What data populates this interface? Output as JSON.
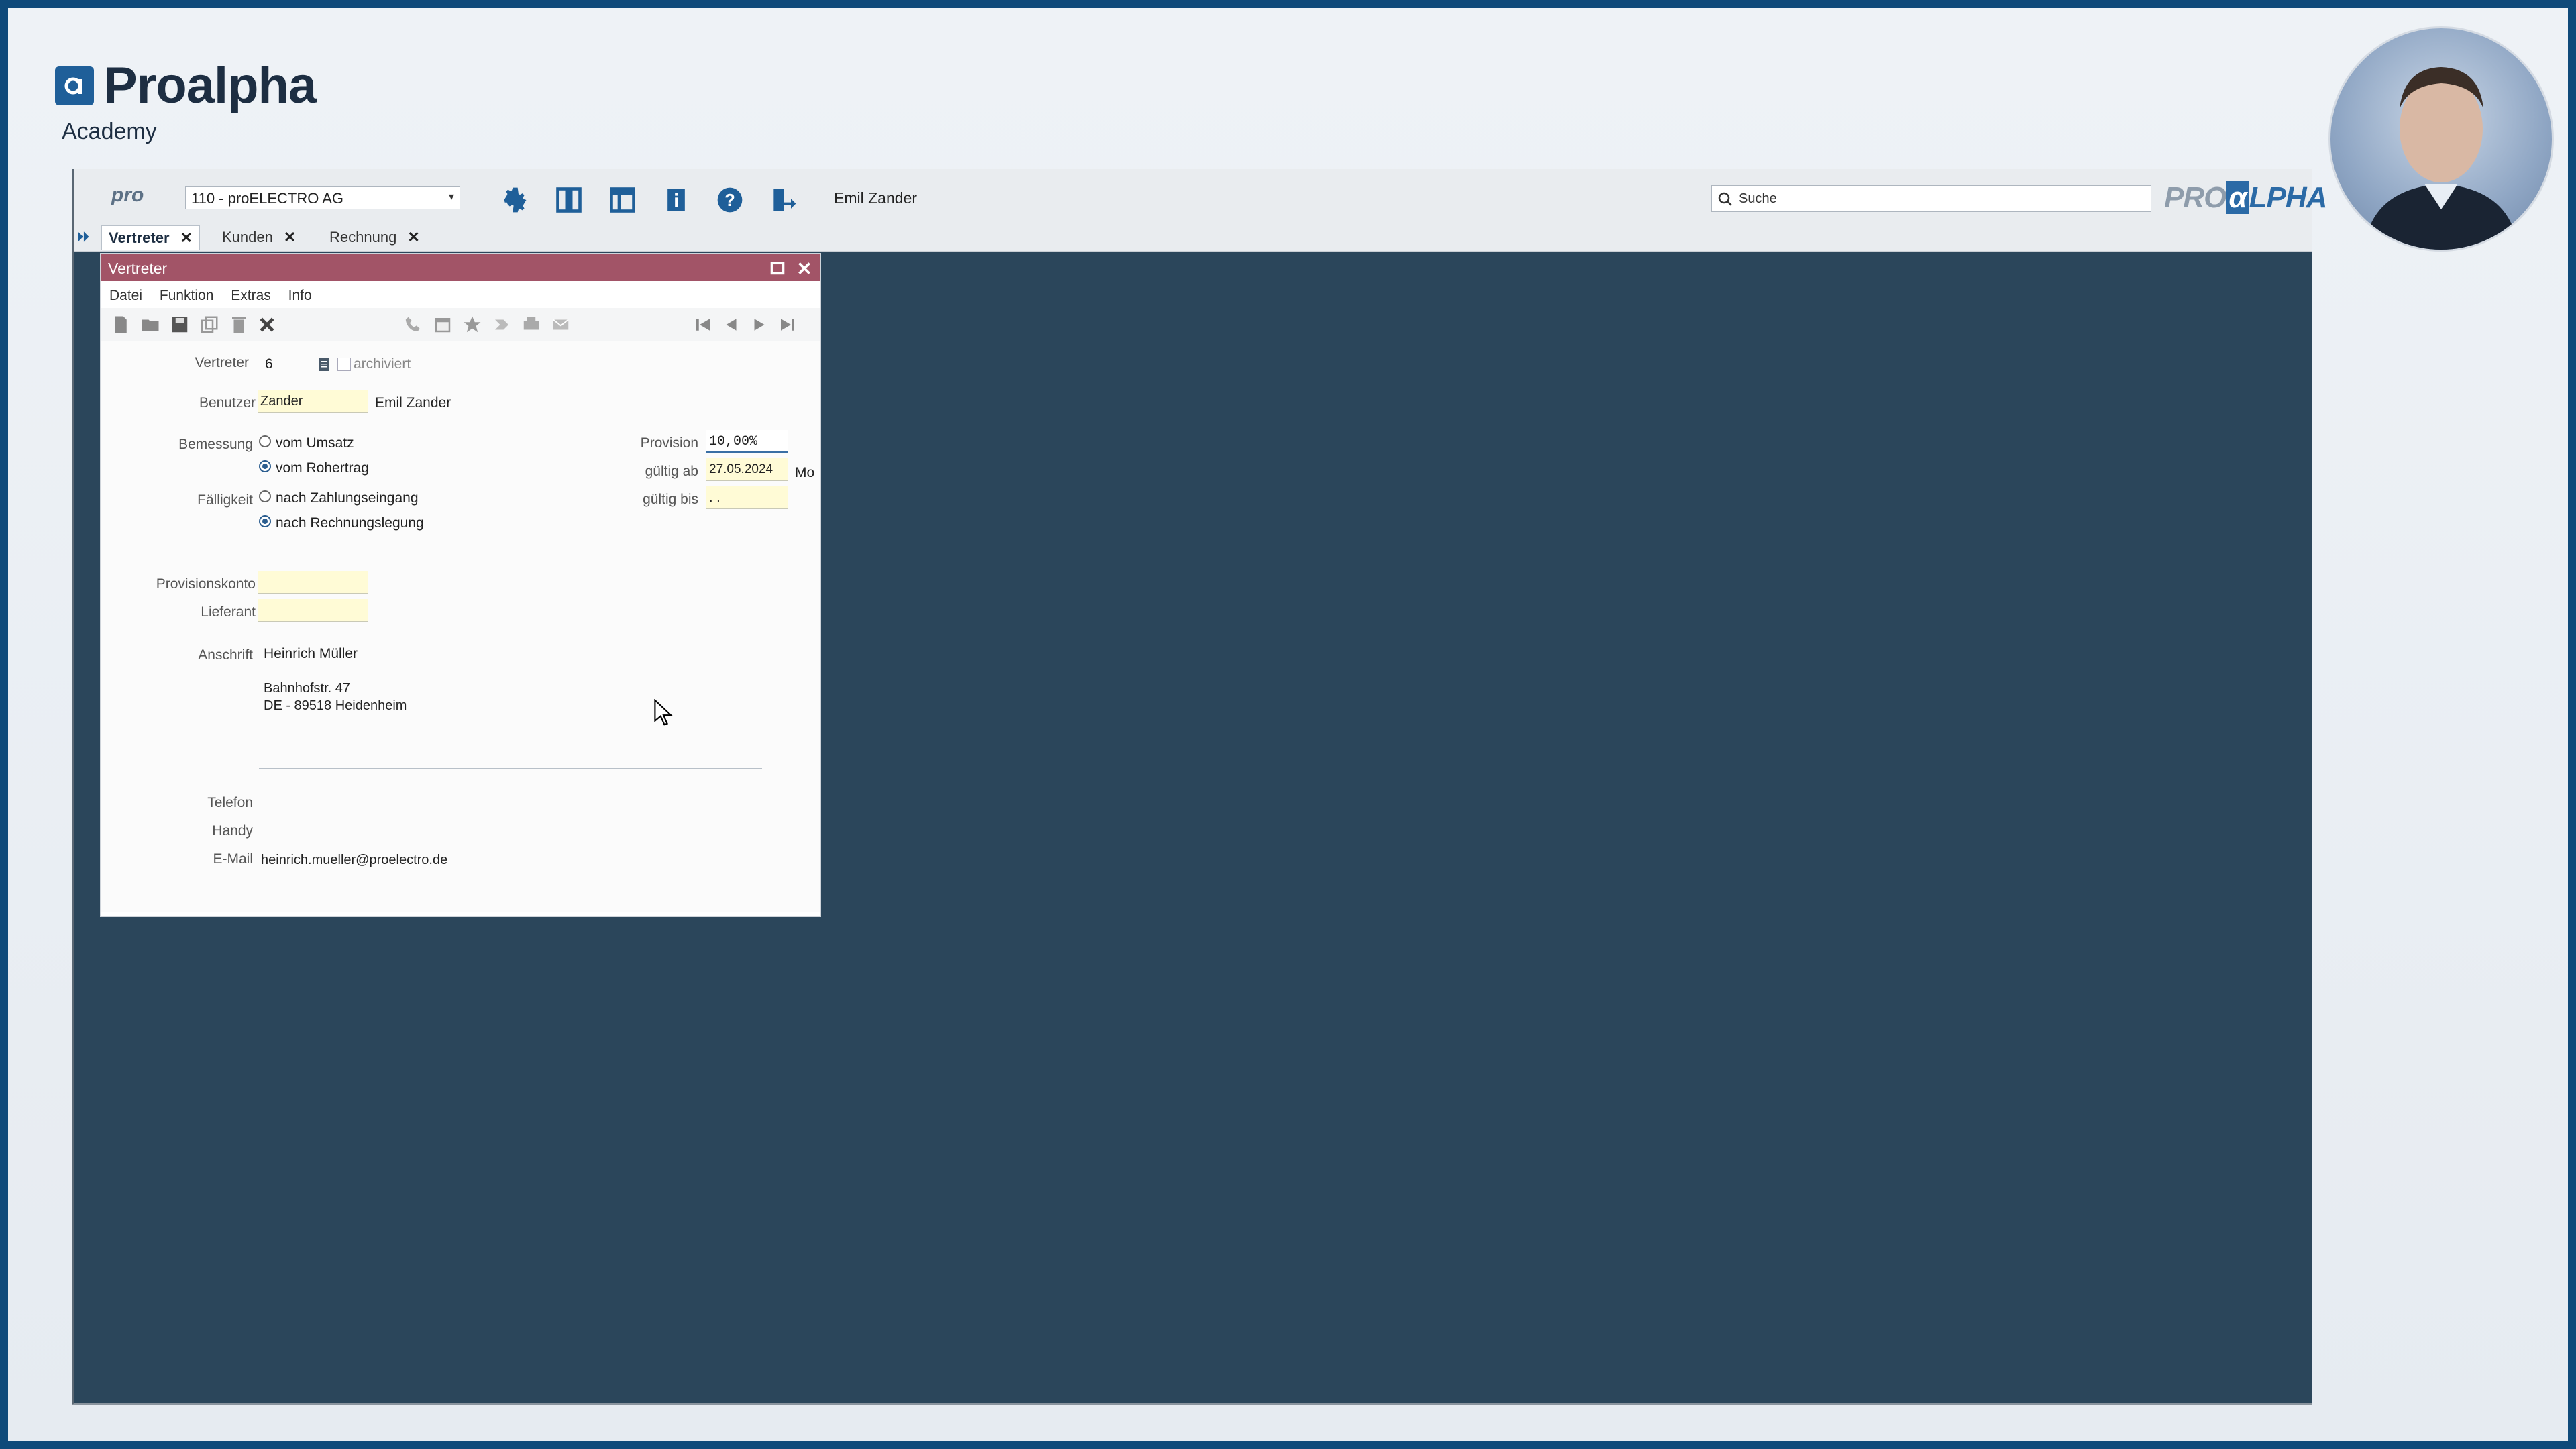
{
  "academy": {
    "brand_name": "Proalpha",
    "subtitle": "Academy"
  },
  "toolbar": {
    "pro_mark": "pro",
    "company": "110 - proELECTRO AG",
    "user": "Emil Zander",
    "search_placeholder": "Suche",
    "logo_left": "PRO",
    "logo_alpha": "α",
    "logo_right": "LPHA",
    "icons": [
      "gear-icon",
      "split-view-icon",
      "layout-icon",
      "info-icon",
      "help-icon",
      "logout-icon"
    ]
  },
  "tabs": [
    {
      "label": "Vertreter",
      "active": true
    },
    {
      "label": "Kunden",
      "active": false
    },
    {
      "label": "Rechnung",
      "active": false
    }
  ],
  "dialog": {
    "title": "Vertreter",
    "menu": [
      "Datei",
      "Funktion",
      "Extras",
      "Info"
    ],
    "form": {
      "vertreter_label": "Vertreter",
      "vertreter_value": "6",
      "archiviert_label": "archiviert",
      "benutzer_label": "Benutzer",
      "benutzer_value": "Zander",
      "benutzer_name": "Emil Zander",
      "bemessung_label": "Bemessung",
      "bemessung_opt1": "vom Umsatz",
      "bemessung_opt2": "vom Rohertrag",
      "faelligkeit_label": "Fälligkeit",
      "faelligkeit_opt1": "nach Zahlungseingang",
      "faelligkeit_opt2": "nach Rechnungslegung",
      "provision_label": "Provision",
      "provision_value": "10,00%",
      "gueltig_ab_label": "gültig ab",
      "gueltig_ab_value": "27.05.2024",
      "gueltig_ab_day": "Mo",
      "gueltig_bis_label": "gültig bis",
      "gueltig_bis_value": ". .",
      "provisionskonto_label": "Provisionskonto",
      "lieferant_label": "Lieferant",
      "anschrift_label": "Anschrift",
      "anschrift_name": "Heinrich Müller",
      "anschrift_street": "Bahnhofstr. 47",
      "anschrift_city": "DE -  89518 Heidenheim",
      "telefon_label": "Telefon",
      "handy_label": "Handy",
      "email_label": "E-Mail",
      "email_value": "heinrich.mueller@proelectro.de"
    }
  },
  "colors": {
    "accent": "#1f5f99",
    "dialog_title": "#a25467",
    "workspace": "#2b465b",
    "required_field": "#fffbd6"
  }
}
